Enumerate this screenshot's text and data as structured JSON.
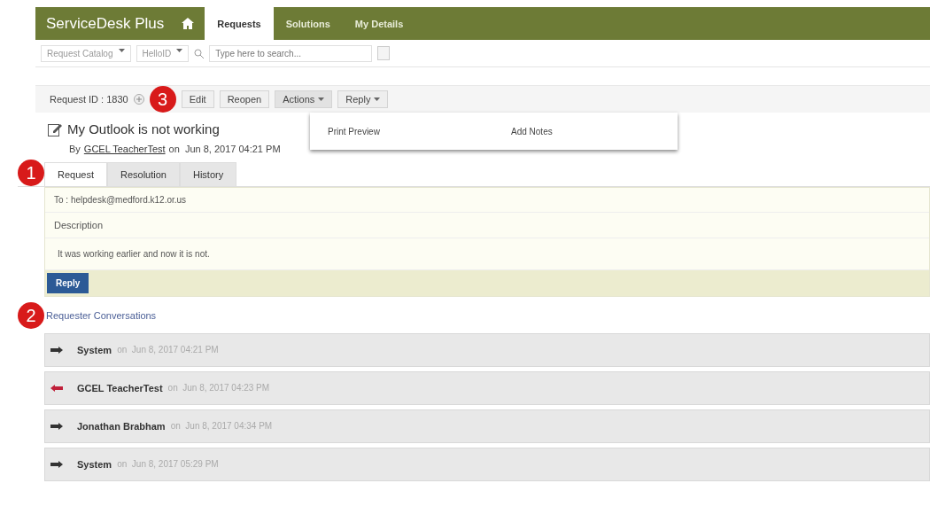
{
  "nav": {
    "logo": "ServiceDesk Plus",
    "tabs": [
      {
        "label": "Requests",
        "selected": true
      },
      {
        "label": "Solutions",
        "selected": false
      },
      {
        "label": "My Details",
        "selected": false
      }
    ]
  },
  "toolbar": {
    "dropdowns": [
      "Request Catalog",
      "HelloID"
    ],
    "search": {
      "placeholder": "Type here to search..."
    }
  },
  "request": {
    "id_label": "Request ID : 1830",
    "callout": "3",
    "buttons": [
      {
        "label": "Edit",
        "kind": "plain"
      },
      {
        "label": "Reopen",
        "kind": "plain"
      },
      {
        "label": "Actions",
        "kind": "menu",
        "expanded": true
      },
      {
        "label": "Reply",
        "kind": "menu",
        "expanded": false
      }
    ],
    "menu": [
      "Print Preview",
      "Add Notes"
    ],
    "title": "My Outlook is not working",
    "by": "By",
    "author": "GCEL TeacherTest",
    "date": "on  Jun 8, 2017 04:21 PM"
  },
  "tabs_callout": "1",
  "tabs": [
    {
      "label": "Request",
      "selected": true
    },
    {
      "label": "Resolution",
      "selected": false
    },
    {
      "label": "History",
      "selected": false
    }
  ],
  "detail": {
    "to": "To : helpdesk@medford.k12.or.us",
    "description_label": "Description",
    "description": "It was working earlier and now it is not.",
    "reply": "Reply"
  },
  "conversations": {
    "callout": "2",
    "title": "Requester Conversations",
    "items": [
      {
        "author": "System",
        "date": "on  Jun 8, 2017 04:21 PM",
        "kind": "outgoing"
      },
      {
        "author": "GCEL TeacherTest",
        "date": "on  Jun 8, 2017 04:23 PM",
        "kind": "incoming"
      },
      {
        "author": "Jonathan Brabham",
        "date": "on  Jun 8, 2017 04:34 PM",
        "kind": "outgoing"
      },
      {
        "author": "System",
        "date": "on  Jun 8, 2017 05:29 PM",
        "kind": "outgoing"
      }
    ]
  }
}
